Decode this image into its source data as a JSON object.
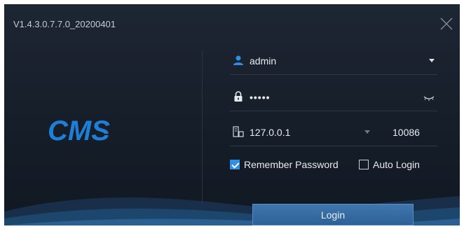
{
  "window": {
    "version": "V1.4.3.0.7.7.0_20200401",
    "logo_text": "CMS"
  },
  "form": {
    "username": "admin",
    "password_masked": "•••••",
    "server_ip": "127.0.0.1",
    "port": "10086",
    "remember_password_label": "Remember Password",
    "remember_password_checked": true,
    "auto_login_label": "Auto Login",
    "auto_login_checked": false,
    "login_label": "Login"
  },
  "icons": {
    "close": "close-icon",
    "user": "user-icon",
    "lock": "lock-icon",
    "eye": "eye-closed-icon",
    "server": "server-icon",
    "dropdown": "chevron-down-icon"
  },
  "colors": {
    "background": "#151d28",
    "accent": "#2f8fe6",
    "logo": "#1f7fd6",
    "button": "#35699f"
  }
}
